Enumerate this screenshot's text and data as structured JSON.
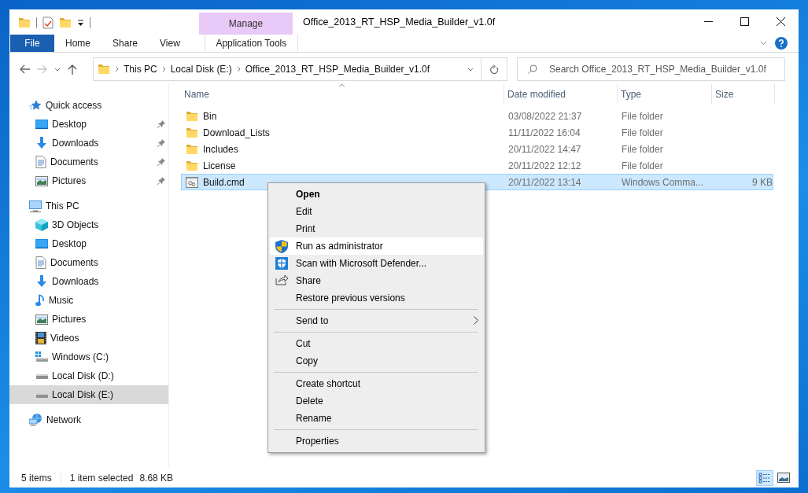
{
  "window": {
    "title": "Office_2013_RT_HSP_Media_Builder_v1.0f"
  },
  "ribbon": {
    "context_group": "Manage",
    "tabs": [
      {
        "label": "File",
        "kind": "file",
        "selected": false
      },
      {
        "label": "Home",
        "kind": "tab",
        "selected": false
      },
      {
        "label": "Share",
        "kind": "tab",
        "selected": false
      },
      {
        "label": "View",
        "kind": "tab",
        "selected": false
      },
      {
        "label": "Application Tools",
        "kind": "contextual",
        "selected": false
      }
    ]
  },
  "address_bar": {
    "crumbs": [
      "This PC",
      "Local Disk (E:)",
      "Office_2013_RT_HSP_Media_Builder_v1.0f"
    ]
  },
  "search": {
    "placeholder": "Search Office_2013_RT_HSP_Media_Builder_v1.0f"
  },
  "sidebar": {
    "items": [
      {
        "label": "Quick access",
        "kind": "quick-access",
        "selected": false,
        "children": [
          {
            "label": "Desktop",
            "kind": "desktop",
            "pinned": true,
            "selected": false
          },
          {
            "label": "Downloads",
            "kind": "downloads",
            "pinned": true,
            "selected": false
          },
          {
            "label": "Documents",
            "kind": "documents",
            "pinned": true,
            "selected": false
          },
          {
            "label": "Pictures",
            "kind": "pictures",
            "pinned": true,
            "selected": false
          }
        ]
      },
      {
        "label": "This PC",
        "kind": "pc",
        "selected": false,
        "children": [
          {
            "label": "3D Objects",
            "kind": "objects",
            "pinned": false,
            "selected": false
          },
          {
            "label": "Desktop",
            "kind": "desktop",
            "pinned": false,
            "selected": false
          },
          {
            "label": "Documents",
            "kind": "documents",
            "pinned": false,
            "selected": false
          },
          {
            "label": "Downloads",
            "kind": "downloads",
            "pinned": false,
            "selected": false
          },
          {
            "label": "Music",
            "kind": "music",
            "pinned": false,
            "selected": false
          },
          {
            "label": "Pictures",
            "kind": "pictures",
            "pinned": false,
            "selected": false
          },
          {
            "label": "Videos",
            "kind": "videos",
            "pinned": false,
            "selected": false
          },
          {
            "label": "Windows (C:)",
            "kind": "system-drive",
            "pinned": false,
            "selected": false
          },
          {
            "label": "Local Disk (D:)",
            "kind": "drive",
            "pinned": false,
            "selected": false
          },
          {
            "label": "Local Disk (E:)",
            "kind": "drive",
            "pinned": false,
            "selected": true
          }
        ]
      },
      {
        "label": "Network",
        "kind": "network",
        "selected": false
      }
    ]
  },
  "file_list": {
    "columns": [
      "Name",
      "Date modified",
      "Type",
      "Size"
    ],
    "rows": [
      {
        "kind": "folder",
        "name": "Bin",
        "date_modified": "03/08/2022 21:37",
        "type": "File folder",
        "selected": false
      },
      {
        "kind": "folder",
        "name": "Download_Lists",
        "date_modified": "11/11/2022 16:04",
        "type": "File folder",
        "selected": false
      },
      {
        "kind": "folder",
        "name": "Includes",
        "date_modified": "20/11/2022 14:47",
        "type": "File folder",
        "selected": false
      },
      {
        "kind": "folder",
        "name": "License",
        "date_modified": "20/11/2022 12:12",
        "type": "File folder",
        "selected": false
      },
      {
        "kind": "script",
        "name": "Build.cmd",
        "date_modified": "20/11/2022 13:14",
        "type": "Windows Comma...",
        "size": "9 KB",
        "selected": true
      }
    ]
  },
  "context_menu": {
    "items": [
      {
        "kind": "item",
        "label": "Open",
        "default": true,
        "selected": false
      },
      {
        "kind": "item",
        "label": "Edit",
        "default": false,
        "selected": false
      },
      {
        "kind": "item",
        "label": "Print",
        "default": false,
        "selected": false
      },
      {
        "kind": "item",
        "label": "Run as administrator",
        "default": false,
        "selected": true
      },
      {
        "kind": "item",
        "label": "Scan with Microsoft Defender...",
        "default": false,
        "selected": false
      },
      {
        "kind": "item",
        "label": "Share",
        "default": false,
        "selected": false
      },
      {
        "kind": "item",
        "label": "Restore previous versions",
        "default": false,
        "selected": false
      },
      {
        "kind": "separator"
      },
      {
        "kind": "submenu",
        "label": "Send to",
        "default": false,
        "selected": false
      },
      {
        "kind": "separator"
      },
      {
        "kind": "item",
        "label": "Cut",
        "default": false,
        "selected": false
      },
      {
        "kind": "item",
        "label": "Copy",
        "default": false,
        "selected": false
      },
      {
        "kind": "separator"
      },
      {
        "kind": "item",
        "label": "Create shortcut",
        "default": false,
        "selected": false
      },
      {
        "kind": "item",
        "label": "Delete",
        "default": false,
        "selected": false
      },
      {
        "kind": "item",
        "label": "Rename",
        "default": false,
        "selected": false
      },
      {
        "kind": "separator"
      },
      {
        "kind": "item",
        "label": "Properties",
        "default": false,
        "selected": false
      }
    ]
  },
  "status_bar": {
    "item_count": "5 items",
    "selection": "1 item selected",
    "selection_size": "8.68 KB",
    "views": [
      {
        "kind": "details",
        "selected": true
      },
      {
        "kind": "large-icons",
        "selected": false
      }
    ]
  }
}
